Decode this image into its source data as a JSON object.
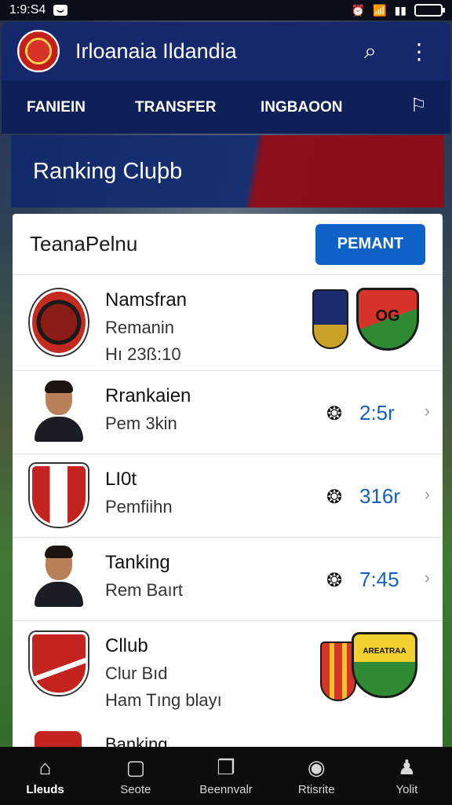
{
  "status_bar": {
    "time": "1:9:S4",
    "right_icons": [
      "alarm-icon",
      "wifi-icon",
      "signal-icon",
      "battery-icon"
    ]
  },
  "app_bar": {
    "title": "Irloanaia Ildandia",
    "logo": "club-logo",
    "actions": [
      "search-icon",
      "more-vert-icon"
    ]
  },
  "tabs": [
    {
      "label": "FANIEIN"
    },
    {
      "label": "TRANSFER"
    },
    {
      "label": "INGBAOON"
    }
  ],
  "tab_icon": "profile-icon",
  "banner": {
    "title": "Ranking Cluþb"
  },
  "card": {
    "title": "TeanaPelnu",
    "action_label": "PEMANT"
  },
  "rows": [
    {
      "title": "Namsfran",
      "subtitle": "Remanin",
      "meta": "Hı 23ß:10",
      "kind": "crest"
    },
    {
      "title": "Rrankaien",
      "subtitle": "Pem 3kin",
      "rank": "2:5r",
      "kind": "avatar"
    },
    {
      "title": "LI0t",
      "subtitle": "Pemfiihn",
      "rank": "316r",
      "kind": "crest"
    },
    {
      "title": "Tanking",
      "subtitle": "Rem Baırt",
      "rank": "7:45",
      "kind": "avatar"
    },
    {
      "title": "Cllub",
      "subtitle": "Clur Bıd",
      "meta": "Ham Tıng blayı",
      "kind": "crest"
    }
  ],
  "row_badges": {
    "row1_text": "OG",
    "row5_text": "AREATRAA"
  },
  "partial_row": {
    "title": "Banking"
  },
  "nav": [
    {
      "label": "Lleuds",
      "icon": "home-icon",
      "active": true
    },
    {
      "label": "Seote",
      "icon": "tablet-icon",
      "active": false
    },
    {
      "label": "Beennvalr",
      "icon": "ticket-icon",
      "active": false
    },
    {
      "label": "Rtisrite",
      "icon": "ball-icon",
      "active": false
    },
    {
      "label": "Yolit",
      "icon": "user-icon",
      "active": false
    }
  ],
  "colors": {
    "app_bar": "#14286b",
    "tab_bar": "#0f1f58",
    "accent": "#0f62c5",
    "rank_value": "#1261c0",
    "banner_red": "#8d0f1b"
  }
}
